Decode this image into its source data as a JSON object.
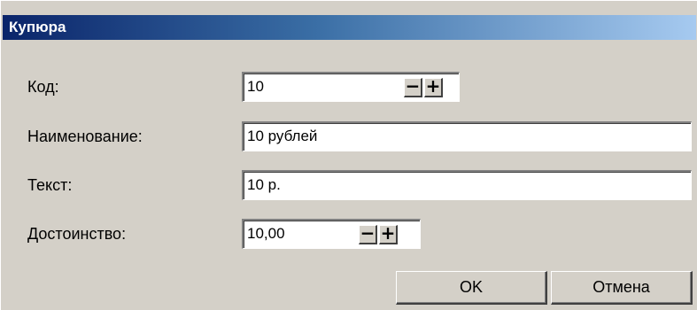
{
  "window": {
    "title": "Купюра"
  },
  "form": {
    "code": {
      "label": "Код:",
      "value": "10",
      "minus": "−",
      "plus": "+"
    },
    "name": {
      "label": "Наименование:",
      "value": "10 рублей"
    },
    "text": {
      "label": "Текст:",
      "value": "10 р."
    },
    "denomination": {
      "label": "Достоинство:",
      "value": "10,00",
      "minus": "−",
      "plus": "+"
    }
  },
  "buttons": {
    "ok": "OK",
    "cancel": "Отмена"
  }
}
